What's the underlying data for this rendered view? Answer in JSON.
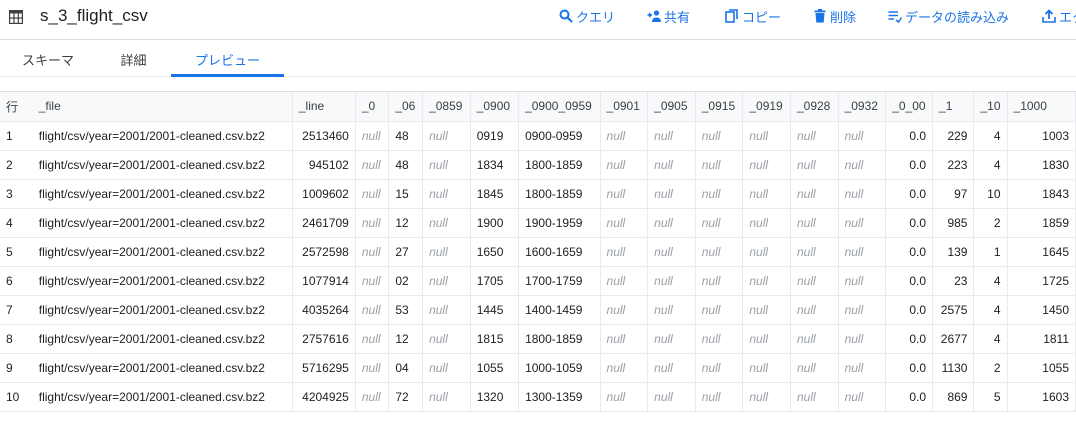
{
  "header": {
    "title": "s_3_flight_csv",
    "actions": {
      "query": "クエリ",
      "share": "共有",
      "copy": "コピー",
      "delete": "削除",
      "import": "データの読み込み",
      "export": "エク"
    }
  },
  "tabs": {
    "schema": "スキーマ",
    "details": "詳細",
    "preview": "プレビュー"
  },
  "colors": {
    "accent": "#1a73e8",
    "null_text": "#9aa0a6"
  },
  "table": {
    "columns": [
      "行",
      "_file",
      "_line",
      "_0",
      "_06",
      "_0859",
      "_0900",
      "_0900_0959",
      "_0901",
      "_0905",
      "_0915",
      "_0919",
      "_0928",
      "_0932",
      "_0_00",
      "_1",
      "_10",
      "_1000"
    ],
    "rows": [
      [
        "1",
        "flight/csv/year=2001/2001-cleaned.csv.bz2",
        "2513460",
        "null",
        "48",
        "null",
        "0919",
        "0900-0959",
        "null",
        "null",
        "null",
        "null",
        "null",
        "null",
        "0.0",
        "229",
        "4",
        "1003"
      ],
      [
        "2",
        "flight/csv/year=2001/2001-cleaned.csv.bz2",
        "945102",
        "null",
        "48",
        "null",
        "1834",
        "1800-1859",
        "null",
        "null",
        "null",
        "null",
        "null",
        "null",
        "0.0",
        "223",
        "4",
        "1830"
      ],
      [
        "3",
        "flight/csv/year=2001/2001-cleaned.csv.bz2",
        "1009602",
        "null",
        "15",
        "null",
        "1845",
        "1800-1859",
        "null",
        "null",
        "null",
        "null",
        "null",
        "null",
        "0.0",
        "97",
        "10",
        "1843"
      ],
      [
        "4",
        "flight/csv/year=2001/2001-cleaned.csv.bz2",
        "2461709",
        "null",
        "12",
        "null",
        "1900",
        "1900-1959",
        "null",
        "null",
        "null",
        "null",
        "null",
        "null",
        "0.0",
        "985",
        "2",
        "1859"
      ],
      [
        "5",
        "flight/csv/year=2001/2001-cleaned.csv.bz2",
        "2572598",
        "null",
        "27",
        "null",
        "1650",
        "1600-1659",
        "null",
        "null",
        "null",
        "null",
        "null",
        "null",
        "0.0",
        "139",
        "1",
        "1645"
      ],
      [
        "6",
        "flight/csv/year=2001/2001-cleaned.csv.bz2",
        "1077914",
        "null",
        "02",
        "null",
        "1705",
        "1700-1759",
        "null",
        "null",
        "null",
        "null",
        "null",
        "null",
        "0.0",
        "23",
        "4",
        "1725"
      ],
      [
        "7",
        "flight/csv/year=2001/2001-cleaned.csv.bz2",
        "4035264",
        "null",
        "53",
        "null",
        "1445",
        "1400-1459",
        "null",
        "null",
        "null",
        "null",
        "null",
        "null",
        "0.0",
        "2575",
        "4",
        "1450"
      ],
      [
        "8",
        "flight/csv/year=2001/2001-cleaned.csv.bz2",
        "2757616",
        "null",
        "12",
        "null",
        "1815",
        "1800-1859",
        "null",
        "null",
        "null",
        "null",
        "null",
        "null",
        "0.0",
        "2677",
        "4",
        "1811"
      ],
      [
        "9",
        "flight/csv/year=2001/2001-cleaned.csv.bz2",
        "5716295",
        "null",
        "04",
        "null",
        "1055",
        "1000-1059",
        "null",
        "null",
        "null",
        "null",
        "null",
        "null",
        "0.0",
        "1130",
        "2",
        "1055"
      ],
      [
        "10",
        "flight/csv/year=2001/2001-cleaned.csv.bz2",
        "4204925",
        "null",
        "72",
        "null",
        "1320",
        "1300-1359",
        "null",
        "null",
        "null",
        "null",
        "null",
        "null",
        "0.0",
        "869",
        "5",
        "1603"
      ]
    ]
  }
}
